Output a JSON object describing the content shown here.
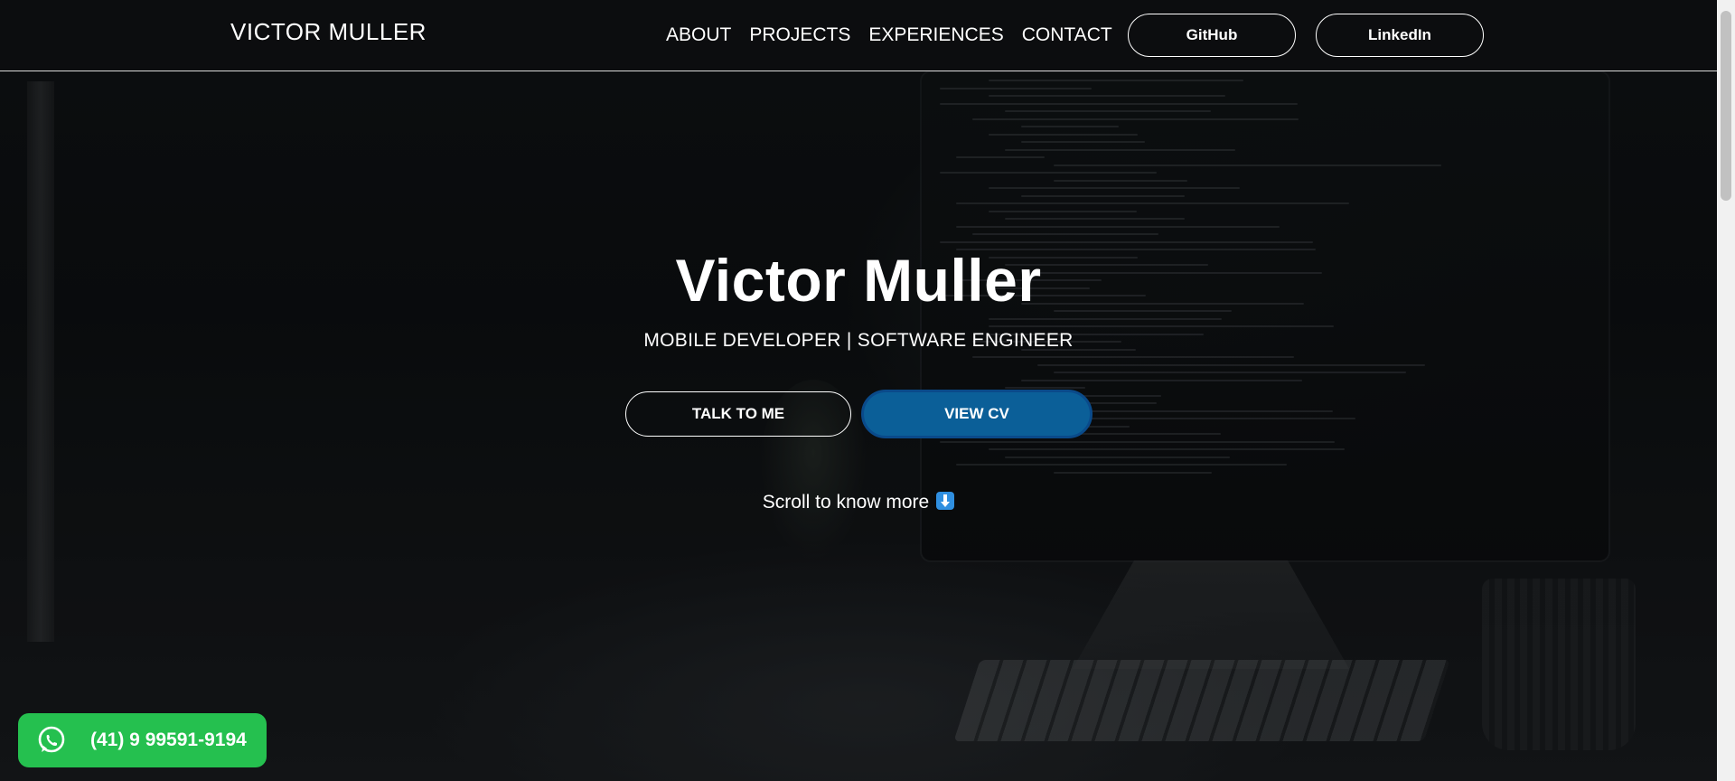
{
  "header": {
    "brand": "VICTOR MULLER",
    "nav": [
      {
        "label": "ABOUT"
      },
      {
        "label": "PROJECTS"
      },
      {
        "label": "EXPERIENCES"
      },
      {
        "label": "CONTACT"
      }
    ],
    "github_label": "GitHub",
    "linkedin_label": "LinkedIn"
  },
  "hero": {
    "title": "Victor Muller",
    "subtitle": "MOBILE DEVELOPER | SOFTWARE ENGINEER",
    "talk_label": "TALK TO ME",
    "cv_label": "VIEW CV",
    "scroll_hint": "Scroll to know more"
  },
  "whatsapp": {
    "phone": "(41) 9 99591-9194",
    "icon": "whatsapp-icon"
  },
  "colors": {
    "accent_blue": "#0b5f98",
    "whatsapp_green": "#25c04f"
  }
}
